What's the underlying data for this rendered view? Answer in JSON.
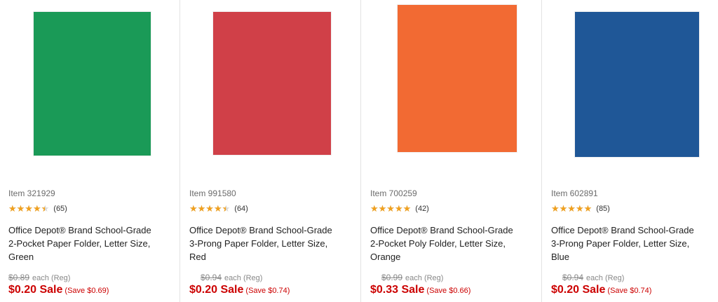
{
  "products": [
    {
      "item": "Item 321929",
      "color_hex": "#1a9a57",
      "rating": 4.5,
      "reviews": "(65)",
      "title_lines": [
        "Office Depot® Brand School-Grade",
        "2-Pocket Paper Folder, Letter Size,",
        "Green"
      ],
      "reg_price": "$0.89",
      "reg_label": "each (Reg)",
      "sale_price": "$0.20 Sale",
      "save_text": "(Save $0.69)",
      "stars_glyph": "★★★★★"
    },
    {
      "item": "Item 991580",
      "color_hex": "#d04048",
      "rating": 4.5,
      "reviews": "(64)",
      "title_lines": [
        "Office Depot® Brand School-Grade",
        "3-Prong Paper Folder, Letter Size,",
        "Red"
      ],
      "reg_price": "$0.94",
      "reg_label": "each (Reg)",
      "sale_price": "$0.20 Sale",
      "save_text": "(Save $0.74)",
      "stars_glyph": "★★★★★"
    },
    {
      "item": "Item 700259",
      "color_hex": "#f26a33",
      "rating": 5,
      "reviews": "(42)",
      "title_lines": [
        "Office Depot® Brand School-Grade",
        "2-Pocket Poly Folder, Letter Size,",
        "Orange"
      ],
      "reg_price": "$0.99",
      "reg_label": "each (Reg)",
      "sale_price": "$0.33 Sale",
      "save_text": "(Save $0.66)",
      "stars_glyph": "★★★★★"
    },
    {
      "item": "Item 602891",
      "color_hex": "#1f5797",
      "rating": 5,
      "reviews": "(85)",
      "title_lines": [
        "Office Depot® Brand School-Grade",
        "3-Prong Paper Folder, Letter Size,",
        "Blue"
      ],
      "reg_price": "$0.94",
      "reg_label": "each (Reg)",
      "sale_price": "$0.20 Sale",
      "save_text": "(Save $0.74)",
      "stars_glyph": "★★★★★"
    }
  ],
  "colors": {
    "sale_red": "#cc0000",
    "star_gold": "#f0a01e"
  }
}
